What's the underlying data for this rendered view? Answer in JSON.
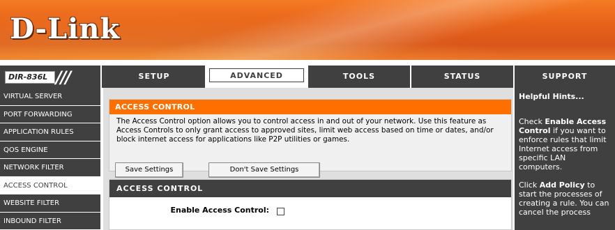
{
  "brand": {
    "logo": "D-Link",
    "model": "DIR-836L"
  },
  "nav": {
    "tabs": [
      {
        "label": "SETUP"
      },
      {
        "label": "ADVANCED"
      },
      {
        "label": "TOOLS"
      },
      {
        "label": "STATUS"
      },
      {
        "label": "SUPPORT"
      }
    ],
    "active_tab": "ADVANCED"
  },
  "sidebar": {
    "items": [
      {
        "label": "VIRTUAL SERVER"
      },
      {
        "label": "PORT FORWARDING"
      },
      {
        "label": "APPLICATION RULES"
      },
      {
        "label": "QOS ENGINE"
      },
      {
        "label": "NETWORK FILTER"
      },
      {
        "label": "ACCESS CONTROL"
      },
      {
        "label": "WEBSITE FILTER"
      },
      {
        "label": "INBOUND FILTER"
      }
    ],
    "active_item": "ACCESS CONTROL"
  },
  "main": {
    "intro": {
      "title": "ACCESS CONTROL",
      "text": "The Access Control option allows you to control access in and out of your network. Use this feature as Access Controls to only grant access to approved sites, limit web access based on time or dates, and/or block internet access for applications like P2P utilities or games.",
      "save_label": "Save Settings",
      "dont_save_label": "Don't Save Settings"
    },
    "settings": {
      "title": "ACCESS CONTROL",
      "enable_label": "Enable Access Control:",
      "enable_checked": false
    }
  },
  "hints": {
    "title": "Helpful Hints...",
    "p1_pre": "Check ",
    "p1_bold": "Enable Access Control",
    "p1_post": " if you want to enforce rules that limit Internet access from specific LAN computers.",
    "p2_pre": "Click ",
    "p2_bold": "Add Policy",
    "p2_post": " to start the processes of creating a rule. You can cancel the process"
  },
  "colors": {
    "accent": "#ff6f00",
    "dark": "#404040",
    "panel_bg": "#dfdfdf"
  }
}
